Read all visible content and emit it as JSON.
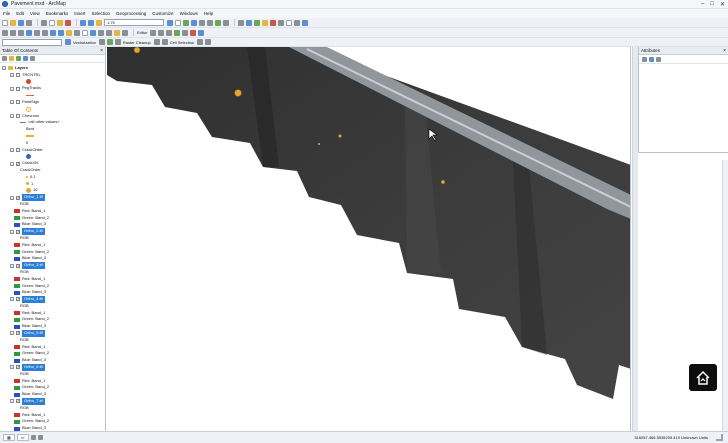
{
  "window": {
    "title": "Pavement.mxd - ArcMap"
  },
  "menu": [
    "File",
    "Edit",
    "View",
    "Bookmarks",
    "Insert",
    "Selection",
    "Geoprocessing",
    "Customize",
    "Windows",
    "Help"
  ],
  "toolbar": {
    "scale": "1:75",
    "editor_label": "Editor",
    "vectorization_label": "Vectorization",
    "raster_cleanup_label": "Raster Cleanup",
    "cell_selection_label": "Cell Selection"
  },
  "toc": {
    "title": "Table Of Contents",
    "root": "Layers",
    "layers": [
      {
        "name": "TRCNTRL",
        "symbol": "dot",
        "color": "#d8442e"
      },
      {
        "name": "PegTracks",
        "symbol": "line",
        "color": "#d86c2e"
      },
      {
        "name": "PaintSign",
        "symbol": "dot",
        "color": "#e6b430"
      },
      {
        "name": "Chevrons",
        "value_field": "<all other values>",
        "heading": "Bcnt",
        "value": "0"
      },
      {
        "name": "CrackOrder",
        "symbol": "dot",
        "color": "#2f63c4"
      },
      {
        "name": "CrackXN",
        "heading": "CrackOrder",
        "classes": [
          "0.1",
          "1",
          "10"
        ]
      }
    ],
    "rasters": [
      {
        "name": "Ortho_1.tif",
        "rgb": "RGB",
        "bands": [
          "Red:   Band_1",
          "Green: Band_2",
          "Blue:  Band_3"
        ]
      },
      {
        "name": "Ortho_2.tif",
        "rgb": "RGB",
        "bands": [
          "Red:   Band_1",
          "Green: Band_2",
          "Blue:  Band_3"
        ]
      },
      {
        "name": "Ortho_3.tif",
        "rgb": "RGB",
        "bands": [
          "Red:   Band_1",
          "Green: Band_2",
          "Blue:  Band_3"
        ]
      },
      {
        "name": "Ortho_4.tif",
        "rgb": "RGB",
        "bands": [
          "Red:   Band_1",
          "Green: Band_2",
          "Blue:  Band_3"
        ]
      },
      {
        "name": "Ortho_5.tif",
        "rgb": "RGB",
        "bands": [
          "Red:   Band_1",
          "Green: Band_2",
          "Blue:  Band_3"
        ]
      },
      {
        "name": "Ortho_6.tif",
        "rgb": "RGB",
        "bands": [
          "Red:   Band_1",
          "Green: Band_2",
          "Blue:  Band_3"
        ]
      },
      {
        "name": "Ortho_7.tif",
        "rgb": "RGB",
        "bands": [
          "Red:   Band_1",
          "Green: Band_2",
          "Blue:  Band_3"
        ]
      }
    ],
    "band_colors": {
      "red": "#c8322a",
      "green": "#2f9a3a",
      "blue": "#2a4fc0"
    }
  },
  "attributes": {
    "title": "Attributes"
  },
  "status": {
    "coords": "316057.466  5535205.419 Unknown Units"
  },
  "colors": {
    "highlight": "#2d7fd6",
    "pavement": "#3d3d3d",
    "points": "#e0a830"
  }
}
